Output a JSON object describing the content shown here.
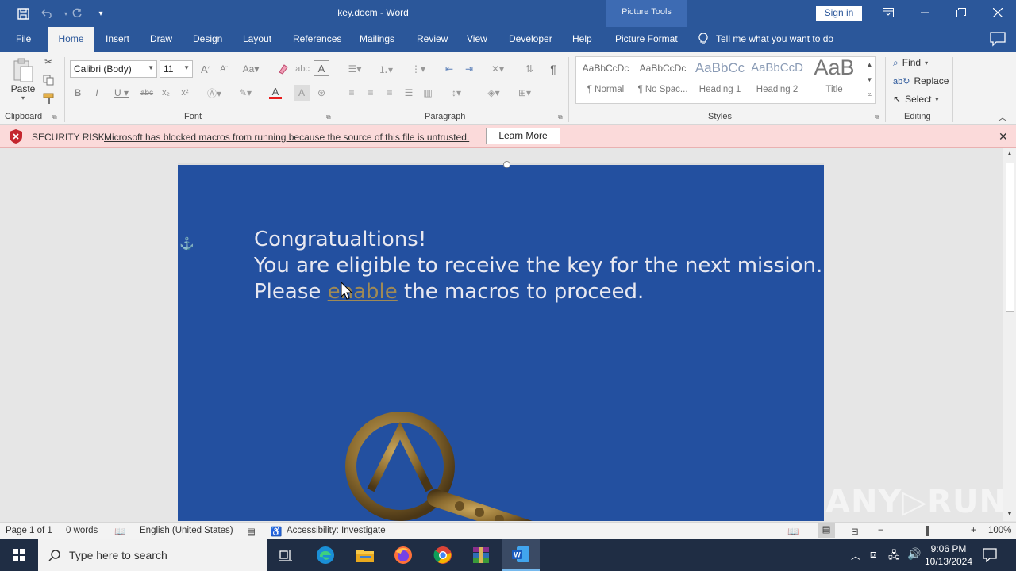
{
  "window": {
    "title": "key.docm  -  Word",
    "contextual_group": "Picture Tools",
    "sign_in": "Sign in"
  },
  "tabs": [
    {
      "label": "File"
    },
    {
      "label": "Home",
      "active": true
    },
    {
      "label": "Insert"
    },
    {
      "label": "Draw"
    },
    {
      "label": "Design"
    },
    {
      "label": "Layout"
    },
    {
      "label": "References"
    },
    {
      "label": "Mailings"
    },
    {
      "label": "Review"
    },
    {
      "label": "View"
    },
    {
      "label": "Developer"
    },
    {
      "label": "Help"
    },
    {
      "label": "Picture Format"
    }
  ],
  "tell_me": "Tell me what you want to do",
  "ribbon": {
    "clipboard": {
      "label": "Clipboard",
      "paste": "Paste"
    },
    "font": {
      "label": "Font",
      "family": "Calibri (Body)",
      "size": "11"
    },
    "paragraph": {
      "label": "Paragraph"
    },
    "styles": {
      "label": "Styles",
      "items": [
        {
          "sample": "AaBbCcDc",
          "name": "¶ Normal"
        },
        {
          "sample": "AaBbCcDc",
          "name": "¶ No Spac..."
        },
        {
          "sample": "AaBbCc",
          "name": "Heading 1"
        },
        {
          "sample": "AaBbCcD",
          "name": "Heading 2"
        },
        {
          "sample": "AaB",
          "name": "Title"
        }
      ]
    },
    "editing": {
      "label": "Editing",
      "find": "Find",
      "replace": "Replace",
      "select": "Select"
    }
  },
  "security_bar": {
    "title": "SECURITY RISK",
    "message": "Microsoft has blocked macros from running because the source of this file is untrusted.",
    "button": "Learn More"
  },
  "document": {
    "line1": "Congratualtions!",
    "line2": "You are eligible to receive the key for the next mission.",
    "line3_pre": "Please ",
    "line3_link": "enable",
    "line3_post": " the macros to proceed."
  },
  "status": {
    "page": "Page 1 of 1",
    "words": "0 words",
    "language": "English (United States)",
    "accessibility": "Accessibility: Investigate",
    "zoom": "100%"
  },
  "taskbar": {
    "search_placeholder": "Type here to search",
    "time": "9:06 PM",
    "date": "10/13/2024"
  },
  "watermark": "ANY RUN",
  "colors": {
    "word_blue": "#2b579a",
    "page_bg": "#2350a0",
    "security_bg": "#fbdada",
    "shield_red": "#c4262e"
  }
}
